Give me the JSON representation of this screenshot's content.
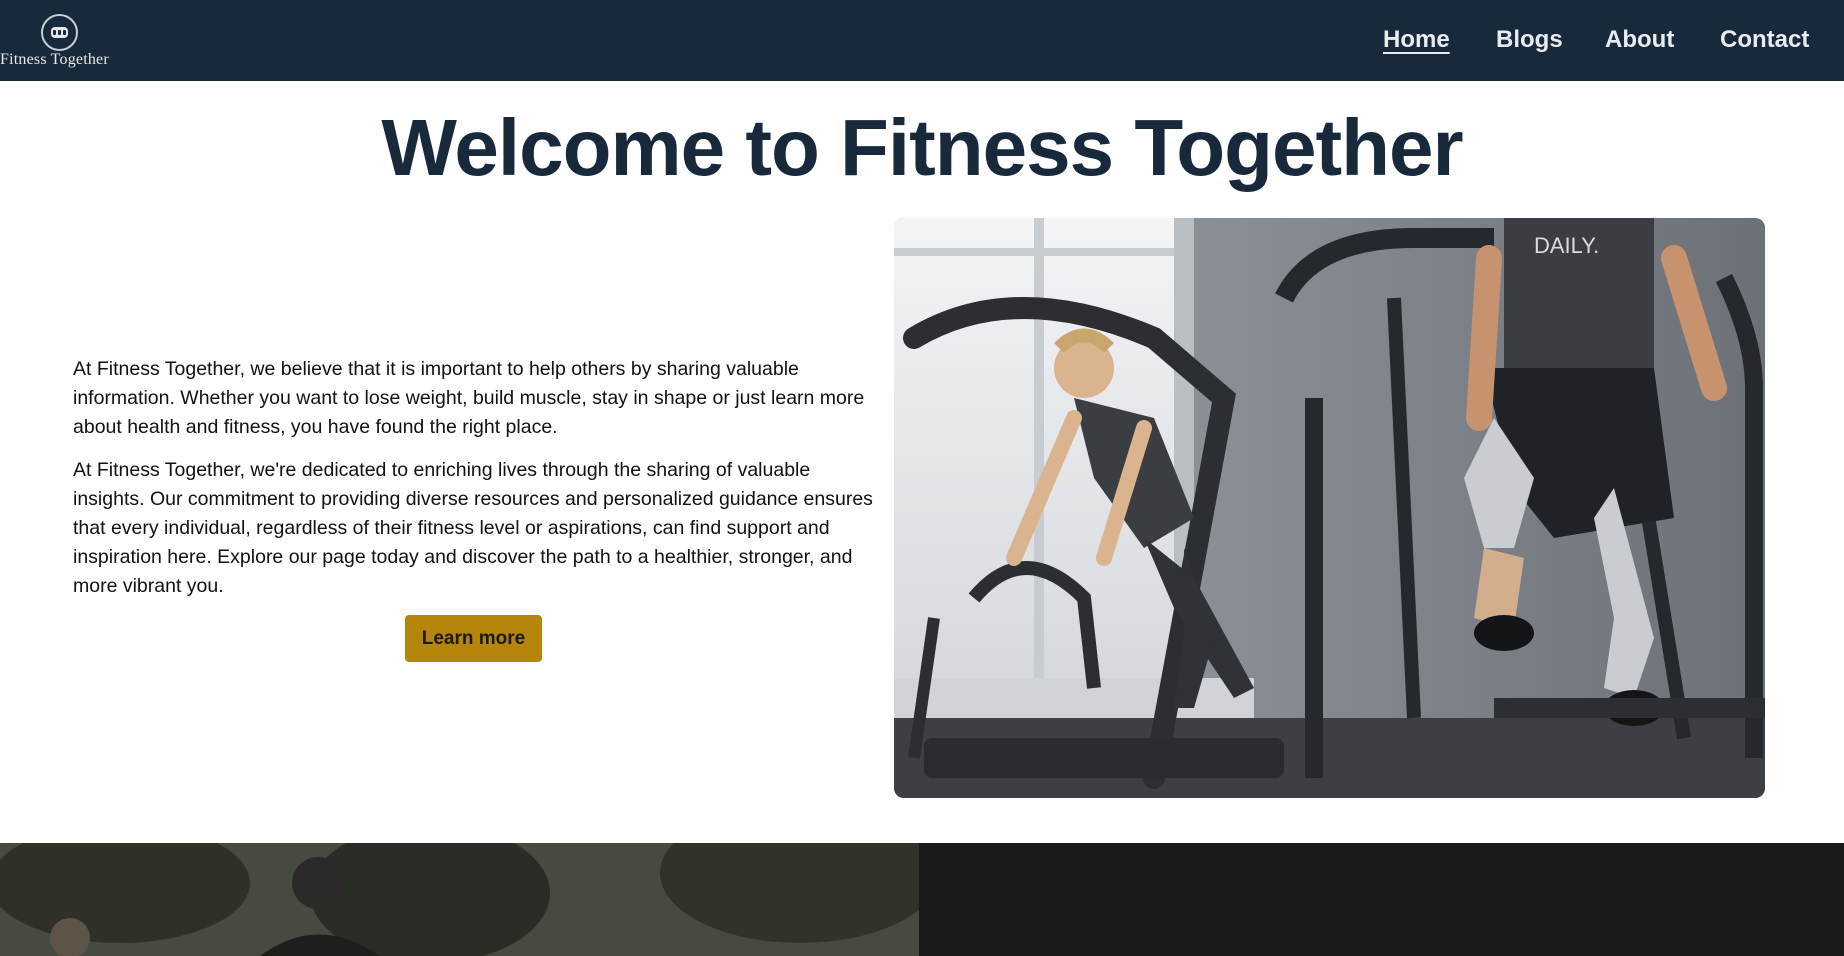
{
  "brand": {
    "name": "Fitness Together",
    "logo_icon": "dumbbell-icon"
  },
  "nav": {
    "items": [
      {
        "label": "Home",
        "active": true
      },
      {
        "label": "Blogs",
        "active": false
      },
      {
        "label": "About",
        "active": false
      },
      {
        "label": "Contact",
        "active": false
      }
    ]
  },
  "hero": {
    "title": "Welcome to Fitness Together",
    "paragraphs": [
      "At Fitness Together, we believe that it is important to help others by sharing valuable information. Whether you want to lose weight, build muscle, stay in shape or just learn more about health and fitness, you have found the right place.",
      "At Fitness Together, we're dedicated to enriching lives through the sharing of valuable insights. Our commitment to providing diverse resources and personalized guidance ensures that every individual, regardless of their fitness level or aspirations, can find support and inspiration here. Explore our page today and discover the path to a healthier, stronger, and more vibrant you."
    ],
    "cta_label": "Learn more",
    "image_text": "DAILY."
  },
  "colors": {
    "navbar": "#17293b",
    "title": "#17293b",
    "accent": "#b5860b",
    "dark_section": "#19191b"
  }
}
